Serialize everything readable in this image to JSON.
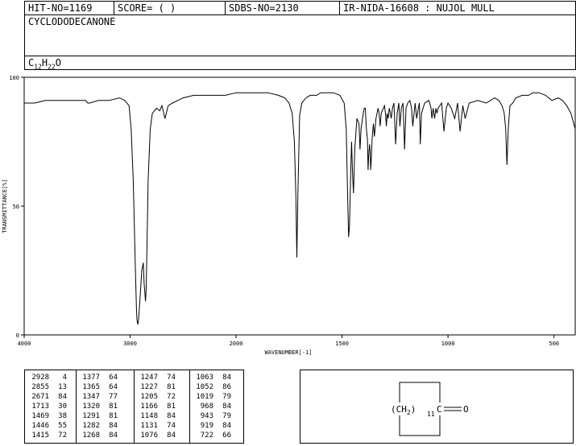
{
  "header": {
    "hit_no": "HIT-NO=1169",
    "score": "SCORE=  (   )",
    "sdbs_no": "SDBS-NO=2130",
    "ir_nida": "IR-NIDA-16608 : NUJOL MULL",
    "compound_name": "CYCLODODECANONE",
    "formula_c": "C",
    "formula_c_sub": "12",
    "formula_h": "H",
    "formula_h_sub": "22",
    "formula_o": "O"
  },
  "chart_data": {
    "type": "line",
    "xlabel": "WAVENUMBER[-1]",
    "ylabel": "TRANSMITTANCE[%]",
    "xlim": [
      4000,
      400
    ],
    "ylim": [
      0,
      100
    ],
    "x_ticks": [
      "4000",
      "3000",
      "2000",
      "1500",
      "1000",
      "500"
    ],
    "y_ticks": [
      "100",
      "50",
      "0"
    ],
    "series": [
      {
        "x": [
          4000,
          3900,
          3800,
          3700,
          3600,
          3500,
          3420,
          3400,
          3380,
          3300,
          3200,
          3100,
          3050,
          3010,
          2990,
          2970,
          2950,
          2940,
          2935,
          2928,
          2920,
          2905,
          2890,
          2875,
          2868,
          2860,
          2855,
          2848,
          2830,
          2810,
          2790,
          2770,
          2750,
          2720,
          2700,
          2671,
          2640,
          2600,
          2500,
          2400,
          2300,
          2200,
          2100,
          2000,
          1900,
          1850,
          1800,
          1770,
          1750,
          1735,
          1725,
          1718,
          1713,
          1708,
          1700,
          1690,
          1680,
          1670,
          1650,
          1620,
          1600,
          1570,
          1540,
          1510,
          1490,
          1480,
          1475,
          1469,
          1465,
          1460,
          1455,
          1450,
          1446,
          1440,
          1430,
          1420,
          1415,
          1410,
          1400,
          1395,
          1390,
          1385,
          1380,
          1377,
          1374,
          1370,
          1367,
          1365,
          1362,
          1358,
          1352,
          1347,
          1340,
          1330,
          1325,
          1320,
          1315,
          1305,
          1300,
          1295,
          1291,
          1287,
          1282,
          1277,
          1272,
          1268,
          1262,
          1255,
          1247,
          1240,
          1232,
          1227,
          1220,
          1212,
          1205,
          1198,
          1190,
          1180,
          1172,
          1166,
          1160,
          1155,
          1148,
          1140,
          1135,
          1131,
          1125,
          1110,
          1090,
          1080,
          1076,
          1070,
          1063,
          1057,
          1052,
          1047,
          1030,
          1019,
          1008,
          1000,
          985,
          968,
          955,
          943,
          930,
          919,
          900,
          860,
          820,
          800,
          780,
          760,
          745,
          735,
          728,
          722,
          716,
          708,
          695,
          680,
          650,
          620,
          600,
          570,
          540,
          510,
          480,
          460,
          440,
          420,
          400
        ],
        "y": [
          90,
          90,
          91,
          91,
          91,
          91,
          91,
          90,
          90,
          91,
          91,
          92,
          91,
          89,
          80,
          60,
          25,
          10,
          6,
          4,
          6,
          15,
          25,
          28,
          20,
          16,
          13,
          18,
          60,
          80,
          86,
          87,
          88,
          87,
          89,
          84,
          89,
          90,
          92,
          93,
          93,
          93,
          93,
          94,
          94,
          94,
          93,
          92,
          90,
          86,
          75,
          55,
          30,
          55,
          85,
          90,
          91,
          92,
          93,
          93,
          94,
          94,
          94,
          93,
          90,
          80,
          60,
          38,
          42,
          60,
          75,
          62,
          55,
          72,
          84,
          82,
          72,
          80,
          86,
          88,
          88,
          80,
          76,
          64,
          70,
          74,
          70,
          64,
          68,
          76,
          82,
          77,
          84,
          88,
          86,
          81,
          86,
          88,
          89,
          86,
          81,
          86,
          84,
          88,
          86,
          84,
          88,
          90,
          74,
          86,
          90,
          81,
          88,
          90,
          72,
          88,
          90,
          91,
          88,
          81,
          86,
          90,
          84,
          88,
          90,
          74,
          86,
          90,
          91,
          88,
          84,
          88,
          84,
          88,
          86,
          88,
          90,
          79,
          88,
          90,
          88,
          84,
          90,
          79,
          89,
          84,
          90,
          91,
          90,
          91,
          92,
          91,
          89,
          86,
          80,
          66,
          80,
          89,
          90,
          92,
          93,
          93,
          94,
          94,
          93,
          91,
          92,
          91,
          89,
          86,
          80
        ]
      }
    ]
  },
  "peak_table": [
    [
      [
        "2928",
        "4"
      ],
      [
        "2855",
        "13"
      ],
      [
        "2671",
        "84"
      ],
      [
        "1713",
        "30"
      ],
      [
        "1469",
        "38"
      ],
      [
        "1446",
        "55"
      ],
      [
        "1415",
        "72"
      ]
    ],
    [
      [
        "1377",
        "64"
      ],
      [
        "1365",
        "64"
      ],
      [
        "1347",
        "77"
      ],
      [
        "1320",
        "81"
      ],
      [
        "1291",
        "81"
      ],
      [
        "1282",
        "84"
      ],
      [
        "1268",
        "84"
      ]
    ],
    [
      [
        "1247",
        "74"
      ],
      [
        "1227",
        "81"
      ],
      [
        "1205",
        "72"
      ],
      [
        "1166",
        "81"
      ],
      [
        "1148",
        "84"
      ],
      [
        "1131",
        "74"
      ],
      [
        "1076",
        "84"
      ]
    ],
    [
      [
        "1063",
        "84"
      ],
      [
        "1052",
        "86"
      ],
      [
        "1019",
        "79"
      ],
      [
        "968",
        "84"
      ],
      [
        "943",
        "79"
      ],
      [
        "919",
        "84"
      ],
      [
        "722",
        "66"
      ]
    ]
  ],
  "structure": {
    "group": "(CH",
    "group_sub": "2",
    "group_close": ")",
    "count": "11",
    "carbonyl_c": "C",
    "oxygen": "O"
  }
}
